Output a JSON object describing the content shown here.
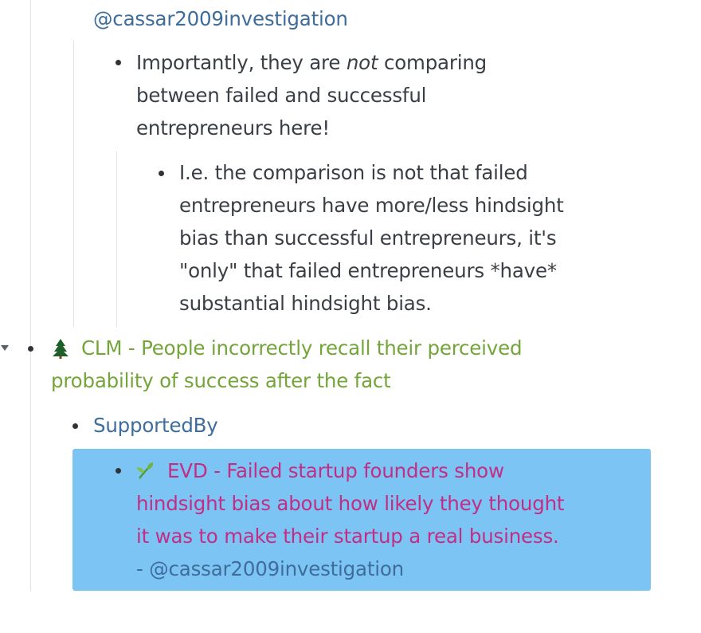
{
  "outline": {
    "top_ref": "@cassar2009investigation",
    "note": {
      "line1_before": "Importantly, they are ",
      "line1_emph": "not",
      "line1_after": " comparing",
      "line2": "between failed and successful",
      "line3": "entrepreneurs here!"
    },
    "subnote": {
      "line1": "I.e. the comparison is not that failed",
      "line2": "entrepreneurs have more/less hindsight",
      "line3": "bias than successful entrepreneurs, it's",
      "line4": "\"only\" that failed entrepreneurs *have*",
      "line5": "substantial hindsight bias."
    },
    "claim": {
      "icon": "evergreen-tree-icon",
      "line1": "CLM - People incorrectly recall their perceived",
      "line2": "probability of success after the fact"
    },
    "supported_by": "SupportedBy",
    "evidence": {
      "icon": "seedling-icon",
      "line1": "EVD - Failed startup founders show",
      "line2": "hindsight bias about how likely they thought",
      "line3": "it was to make their startup a real business.",
      "line4": "- @cassar2009investigation"
    }
  },
  "colors": {
    "link": "#3f6d9b",
    "claim": "#74a53a",
    "evidence": "#c22e85",
    "highlight": "#7cc4f3"
  }
}
